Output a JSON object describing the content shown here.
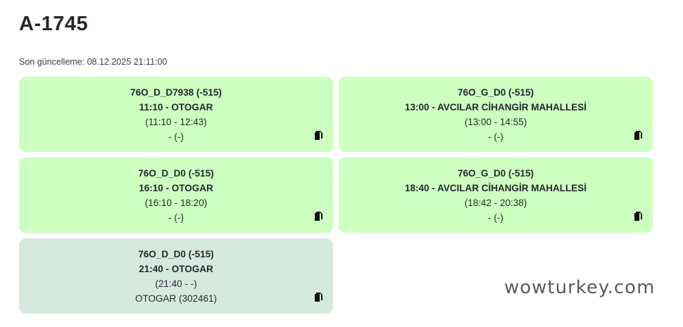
{
  "header": {
    "title": "A-1745",
    "updated_label": "Son güncelleme: 08.12.2025 21:11:00"
  },
  "trips": [
    {
      "code": "76O_D_D7938 (-515)",
      "departure": "11:10 - OTOGAR",
      "time_range": "(11:10 - 12:43)",
      "status": "- (-)",
      "state": "active"
    },
    {
      "code": "76O_G_D0 (-515)",
      "departure": "13:00 - AVCILAR CİHANGİR MAHALLESİ",
      "time_range": "(13:00 - 14:55)",
      "status": "- (-)",
      "state": "active"
    },
    {
      "code": "76O_D_D0 (-515)",
      "departure": "16:10 - OTOGAR",
      "time_range": "(16:10 - 18:20)",
      "status": "- (-)",
      "state": "active"
    },
    {
      "code": "76O_G_D0 (-515)",
      "departure": "18:40 - AVCILAR CİHANGİR MAHALLESİ",
      "time_range": "(18:42 - 20:38)",
      "status": "- (-)",
      "state": "active"
    },
    {
      "code": "76O_D_D0 (-515)",
      "departure": "21:40 - OTOGAR",
      "time_range": "(21:40 - -)",
      "status": "OTOGAR (302461)",
      "state": "current"
    }
  ],
  "icons": {
    "copy": "copy-icon"
  },
  "colors": {
    "card_active": "#ccffc0",
    "card_current": "#d6e9de",
    "text": "#262730"
  },
  "watermark": "wowturkey.com"
}
